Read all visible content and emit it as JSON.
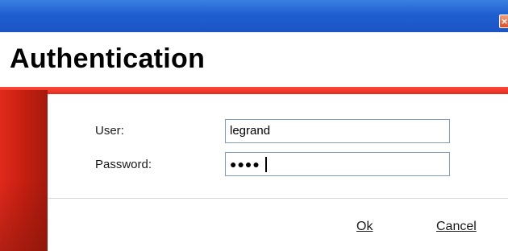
{
  "window": {
    "close_glyph": "×"
  },
  "header": {
    "title": "Authentication"
  },
  "form": {
    "user_label": "User:",
    "user_value": "legrand",
    "password_label": "Password:",
    "password_value": "●●●●"
  },
  "actions": {
    "ok_label": "Ok",
    "cancel_label": "Cancel"
  },
  "colors": {
    "titlebar": "#1f5fd0",
    "accent_red": "#e02d1f",
    "input_border": "#7f9db9"
  }
}
